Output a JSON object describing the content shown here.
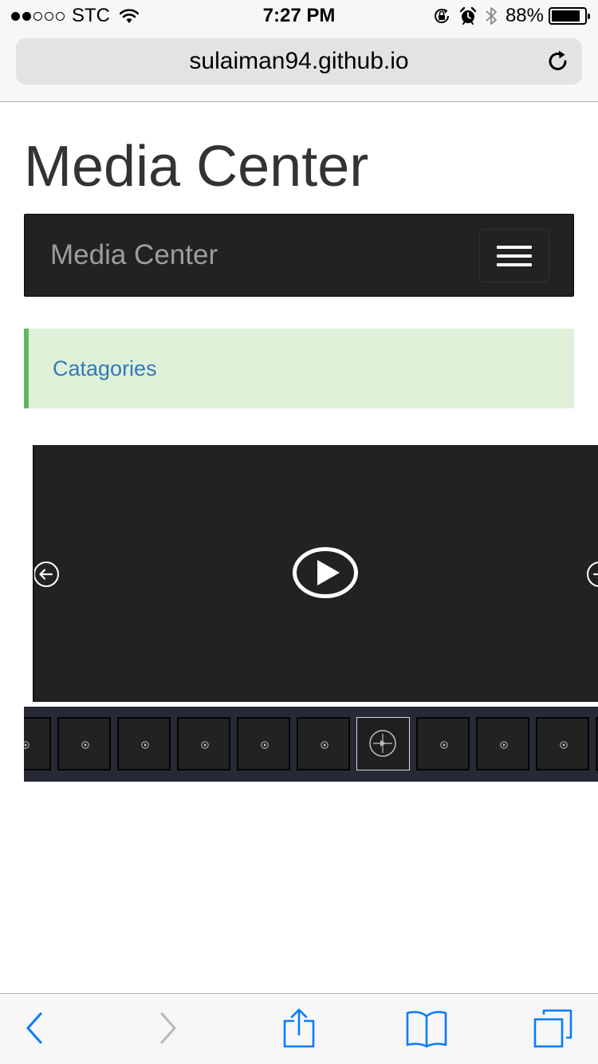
{
  "status_bar": {
    "carrier": "STC",
    "signal_bars_filled": 2,
    "signal_bars_total": 5,
    "time": "7:27 PM",
    "battery_percent_label": "88%",
    "battery_level": 0.88
  },
  "browser": {
    "url": "sulaiman94.github.io"
  },
  "page": {
    "title": "Media Center",
    "navbar": {
      "brand": "Media Center"
    },
    "alert": {
      "link_text": "Catagories"
    }
  },
  "gallery": {
    "thumbnail_count": 10,
    "active_thumbnail_index": 5
  },
  "colors": {
    "navbar_bg": "#222222",
    "brand_text": "#9d9d9d",
    "alert_bg": "#dff0d8",
    "alert_border": "#5cb85c",
    "link": "#337ab7",
    "ios_blue": "#0a7aff"
  },
  "icons": {
    "status": [
      "wifi-icon",
      "orientation-lock-icon",
      "alarm-icon",
      "bluetooth-icon",
      "battery-icon"
    ],
    "browser": [
      "reload-icon"
    ],
    "player": [
      "play-icon",
      "arrow-left-icon",
      "arrow-right-icon"
    ],
    "toolbar": [
      "back-icon",
      "forward-icon",
      "share-icon",
      "bookmarks-icon",
      "tabs-icon"
    ]
  }
}
